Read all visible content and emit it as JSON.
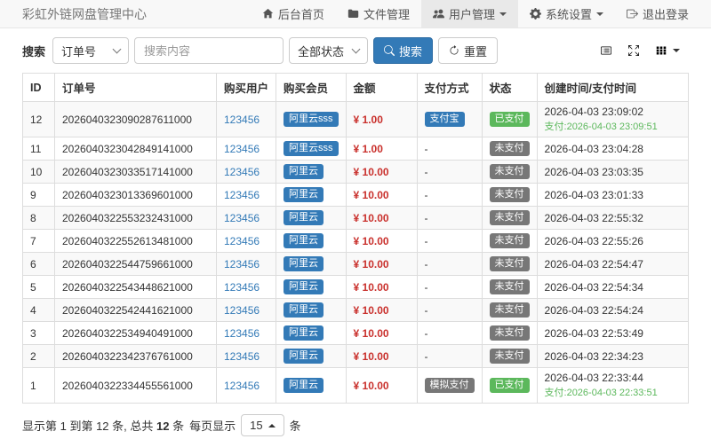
{
  "app": {
    "title": "彩虹外链网盘管理中心"
  },
  "navbar": {
    "items": [
      {
        "label": "后台首页",
        "icon": "home-icon"
      },
      {
        "label": "文件管理",
        "icon": "folder-icon"
      },
      {
        "label": "用户管理",
        "icon": "users-icon",
        "active": true,
        "has_caret": true
      },
      {
        "label": "系统设置",
        "icon": "gear-icon",
        "has_caret": true
      },
      {
        "label": "退出登录",
        "icon": "sign-out-icon"
      }
    ]
  },
  "search": {
    "label": "搜索",
    "field_select_value": "订单号",
    "input_placeholder": "搜索内容",
    "status_select_value": "全部状态",
    "search_button_label": "搜索",
    "reset_button_label": "重置"
  },
  "toolbar_icons": [
    "detail-view-icon",
    "fullscreen-icon",
    "columns-icon"
  ],
  "table": {
    "columns": [
      "ID",
      "订单号",
      "购买用户",
      "购买会员",
      "金额",
      "支付方式",
      "状态",
      "创建时间/支付时间"
    ],
    "rows": [
      {
        "id": "12",
        "order_no": "2026040323090287611000",
        "user": "123456",
        "plan": "阿里云sss",
        "amount": "¥ 1.00",
        "pay_method": "支付宝",
        "pay_method_style": "primary",
        "status": "已支付",
        "status_style": "success",
        "created": "2026-04-03 23:09:02",
        "paid": "支付:2026-04-03 23:09:51"
      },
      {
        "id": "11",
        "order_no": "2026040323042849141000",
        "user": "123456",
        "plan": "阿里云sss",
        "amount": "¥ 1.00",
        "pay_method": "-",
        "pay_method_style": "none",
        "status": "未支付",
        "status_style": "default",
        "created": "2026-04-03 23:04:28",
        "paid": ""
      },
      {
        "id": "10",
        "order_no": "2026040323033517141000",
        "user": "123456",
        "plan": "阿里云",
        "amount": "¥ 10.00",
        "pay_method": "-",
        "pay_method_style": "none",
        "status": "未支付",
        "status_style": "default",
        "created": "2026-04-03 23:03:35",
        "paid": ""
      },
      {
        "id": "9",
        "order_no": "2026040323013369601000",
        "user": "123456",
        "plan": "阿里云",
        "amount": "¥ 10.00",
        "pay_method": "-",
        "pay_method_style": "none",
        "status": "未支付",
        "status_style": "default",
        "created": "2026-04-03 23:01:33",
        "paid": ""
      },
      {
        "id": "8",
        "order_no": "2026040322553232431000",
        "user": "123456",
        "plan": "阿里云",
        "amount": "¥ 10.00",
        "pay_method": "-",
        "pay_method_style": "none",
        "status": "未支付",
        "status_style": "default",
        "created": "2026-04-03 22:55:32",
        "paid": ""
      },
      {
        "id": "7",
        "order_no": "2026040322552613481000",
        "user": "123456",
        "plan": "阿里云",
        "amount": "¥ 10.00",
        "pay_method": "-",
        "pay_method_style": "none",
        "status": "未支付",
        "status_style": "default",
        "created": "2026-04-03 22:55:26",
        "paid": ""
      },
      {
        "id": "6",
        "order_no": "2026040322544759661000",
        "user": "123456",
        "plan": "阿里云",
        "amount": "¥ 10.00",
        "pay_method": "-",
        "pay_method_style": "none",
        "status": "未支付",
        "status_style": "default",
        "created": "2026-04-03 22:54:47",
        "paid": ""
      },
      {
        "id": "5",
        "order_no": "2026040322543448621000",
        "user": "123456",
        "plan": "阿里云",
        "amount": "¥ 10.00",
        "pay_method": "-",
        "pay_method_style": "none",
        "status": "未支付",
        "status_style": "default",
        "created": "2026-04-03 22:54:34",
        "paid": ""
      },
      {
        "id": "4",
        "order_no": "2026040322542441621000",
        "user": "123456",
        "plan": "阿里云",
        "amount": "¥ 10.00",
        "pay_method": "-",
        "pay_method_style": "none",
        "status": "未支付",
        "status_style": "default",
        "created": "2026-04-03 22:54:24",
        "paid": ""
      },
      {
        "id": "3",
        "order_no": "2026040322534940491000",
        "user": "123456",
        "plan": "阿里云",
        "amount": "¥ 10.00",
        "pay_method": "-",
        "pay_method_style": "none",
        "status": "未支付",
        "status_style": "default",
        "created": "2026-04-03 22:53:49",
        "paid": ""
      },
      {
        "id": "2",
        "order_no": "2026040322342376761000",
        "user": "123456",
        "plan": "阿里云",
        "amount": "¥ 10.00",
        "pay_method": "-",
        "pay_method_style": "none",
        "status": "未支付",
        "status_style": "default",
        "created": "2026-04-03 22:34:23",
        "paid": ""
      },
      {
        "id": "1",
        "order_no": "2026040322334455561000",
        "user": "123456",
        "plan": "阿里云",
        "amount": "¥ 10.00",
        "pay_method": "模拟支付",
        "pay_method_style": "default",
        "status": "已支付",
        "status_style": "success",
        "created": "2026-04-03 22:33:44",
        "paid": "支付:2026-04-03 22:33:51"
      }
    ]
  },
  "pagination": {
    "info_prefix": "显示第 1 到第 12 条, 总共 ",
    "total": "12",
    "info_suffix": " 条",
    "page_size_label": "每页显示",
    "page_size": "15",
    "unit": "条"
  },
  "colors": {
    "primary": "#337ab7",
    "success": "#5cb85c",
    "muted_badge": "#777",
    "amount_red": "#c9302c",
    "paid_time_green": "#5cb85c",
    "navbar_bg": "#f8f8f8",
    "stripe_bg": "#f9f9f9"
  }
}
